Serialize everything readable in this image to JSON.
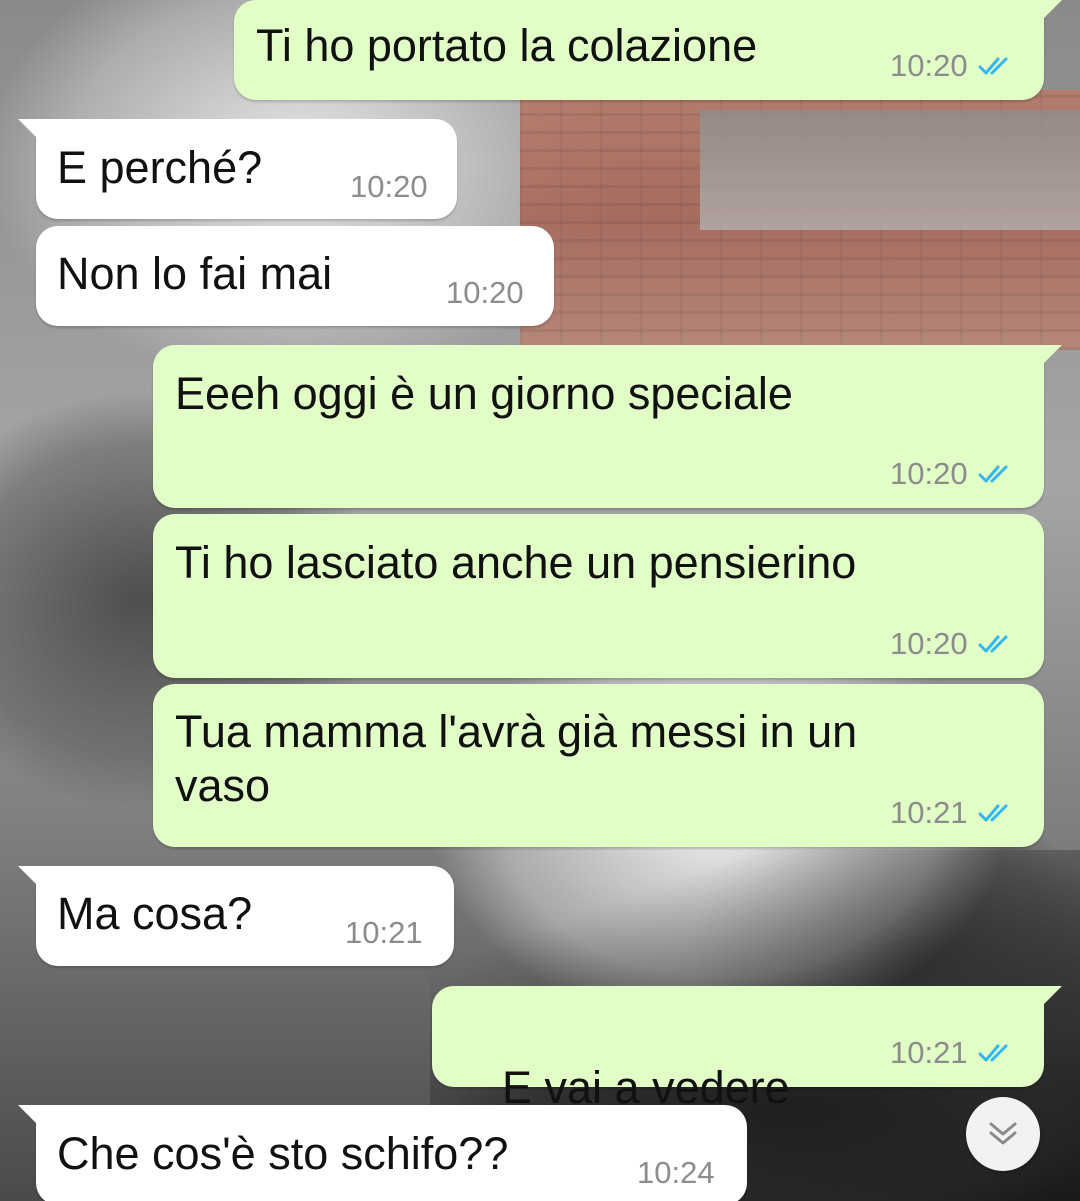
{
  "colors": {
    "outgoing_bubble": "#e1fec6",
    "incoming_bubble": "#ffffff",
    "read_ticks": "#34b7f1",
    "time_text": "#8c8c8c"
  },
  "messages": [
    {
      "direction": "outgoing",
      "text": "Ti ho portato la colazione",
      "time": "10:20",
      "status_icon": "double-check-read-icon"
    },
    {
      "direction": "incoming",
      "text": "E perché?",
      "time": "10:20"
    },
    {
      "direction": "incoming",
      "text": "Non lo fai mai",
      "time": "10:20"
    },
    {
      "direction": "outgoing",
      "text": "Eeeh oggi è un giorno speciale",
      "time": "10:20",
      "status_icon": "double-check-read-icon"
    },
    {
      "direction": "outgoing",
      "text": "Ti ho lasciato anche un pensierino",
      "time": "10:20",
      "status_icon": "double-check-read-icon"
    },
    {
      "direction": "outgoing",
      "text": "Tua mamma l'avrà già messi in un\nvaso",
      "time": "10:21",
      "status_icon": "double-check-read-icon"
    },
    {
      "direction": "incoming",
      "text": "Ma cosa?",
      "time": "10:21"
    },
    {
      "direction": "outgoing",
      "text": "E vai a vedere",
      "emoji": "☺️",
      "time": "10:21",
      "status_icon": "double-check-read-icon"
    },
    {
      "direction": "incoming",
      "text": "Che cos'è sto schifo??",
      "time": "10:24"
    }
  ],
  "scroll_button": {
    "icon": "chevrons-down-icon"
  }
}
